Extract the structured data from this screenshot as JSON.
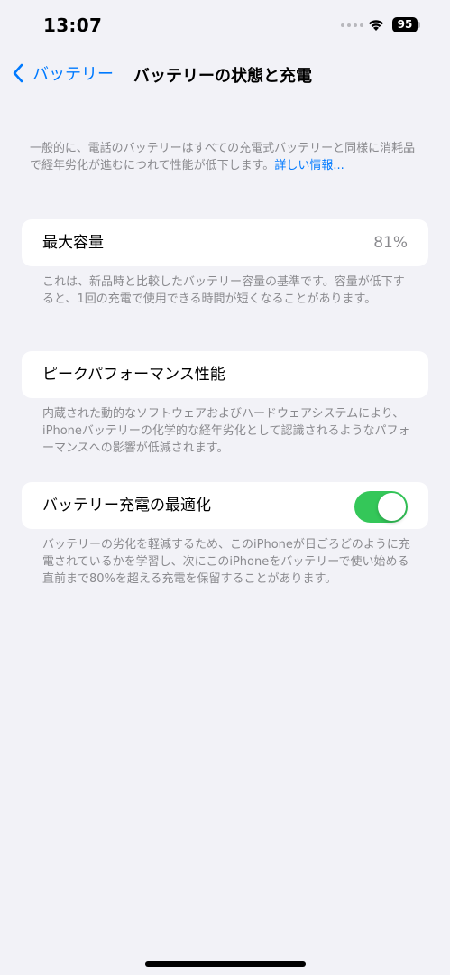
{
  "status_bar": {
    "time": "13:07",
    "battery_level": "95"
  },
  "nav": {
    "back_label": "バッテリー",
    "title": "バッテリーの状態と充電"
  },
  "intro": {
    "text": "一般的に、電話のバッテリーはすべての充電式バッテリーと同様に消耗品で経年劣化が進むにつれて性能が低下します。",
    "link": "詳しい情報..."
  },
  "max_capacity": {
    "label": "最大容量",
    "value": "81%",
    "footer": "これは、新品時と比較したバッテリー容量の基準です。容量が低下すると、1回の充電で使用できる時間が短くなることがあります。"
  },
  "peak_performance": {
    "label": "ピークパフォーマンス性能",
    "footer": "内蔵された動的なソフトウェアおよびハードウェアシステムにより、iPhoneバッテリーの化学的な経年劣化として認識されるようなパフォーマンスへの影響が低減されます。"
  },
  "optimized_charging": {
    "label": "バッテリー充電の最適化",
    "enabled": true,
    "footer": "バッテリーの劣化を軽減するため、このiPhoneが日ごろどのように充電されているかを学習し、次にこのiPhoneをバッテリーで使い始める直前まで80%を超える充電を保留することがあります。"
  },
  "colors": {
    "accent": "#007aff",
    "toggle_on": "#34c759",
    "background": "#f2f2f7",
    "secondary_text": "#8a8a8e"
  }
}
